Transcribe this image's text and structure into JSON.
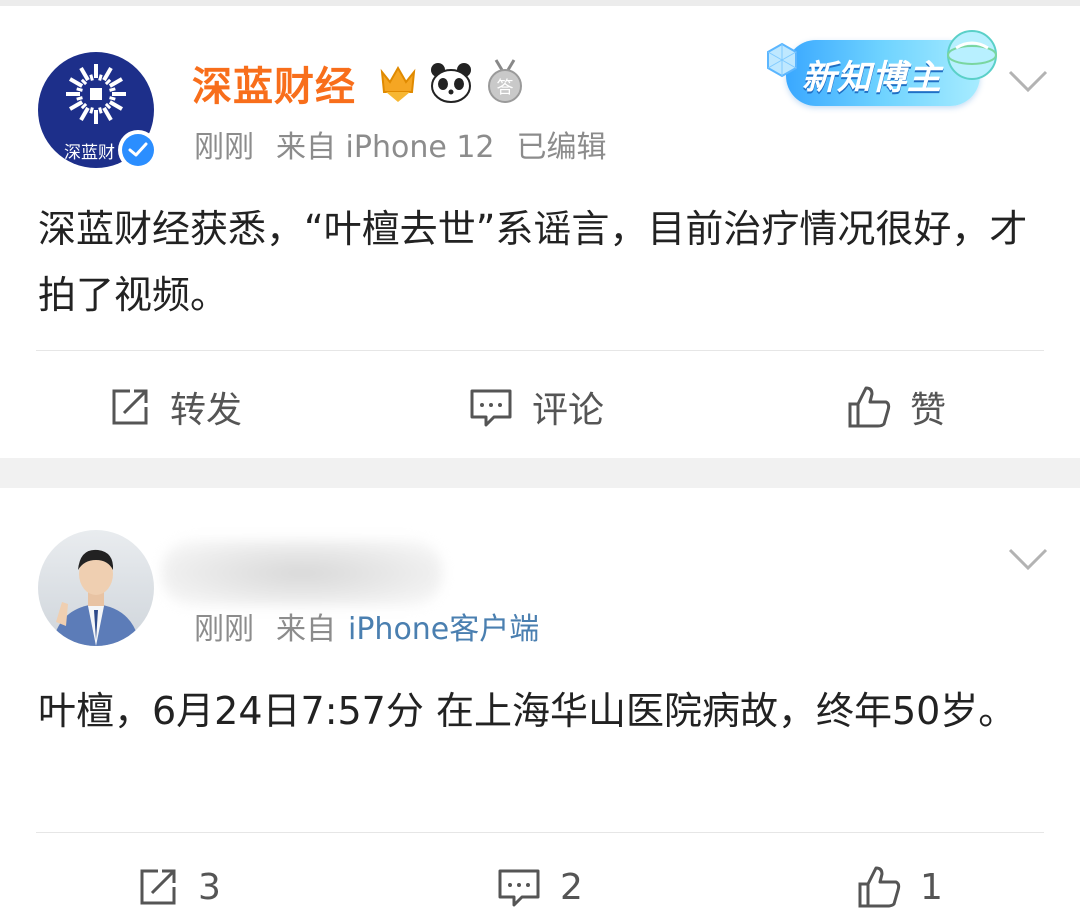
{
  "posts": [
    {
      "username": "深蓝财经",
      "avatar_text": "深蓝财",
      "time": "刚刚",
      "source": "来自 iPhone 12",
      "edited": "已编辑",
      "promo_badge": "新知博主",
      "text": "深蓝财经获悉，“叶檀去世”系谣言，目前治疗情况很好，才拍了视频。",
      "actions": {
        "repost": "转发",
        "comment": "评论",
        "like": "赞"
      }
    },
    {
      "time": "刚刚",
      "source_prefix": "来自",
      "source_link": "iPhone客户端",
      "text": "叶檀，6月24日7:57分 在上海华山医院病故，终年50岁。",
      "actions": {
        "repost": "3",
        "comment": "2",
        "like": "1"
      }
    }
  ],
  "colors": {
    "username": "#f86e1b",
    "verified": "#2b8eff",
    "meta": "#8c8c8c",
    "link": "#4a7fb0",
    "logo_bg": "#1d2f8a"
  },
  "icons": [
    "chevron-down-icon",
    "repost-icon",
    "comment-icon",
    "like-icon",
    "verified-icon",
    "crown-badge-icon",
    "panda-badge-icon",
    "answer-medal-icon"
  ]
}
